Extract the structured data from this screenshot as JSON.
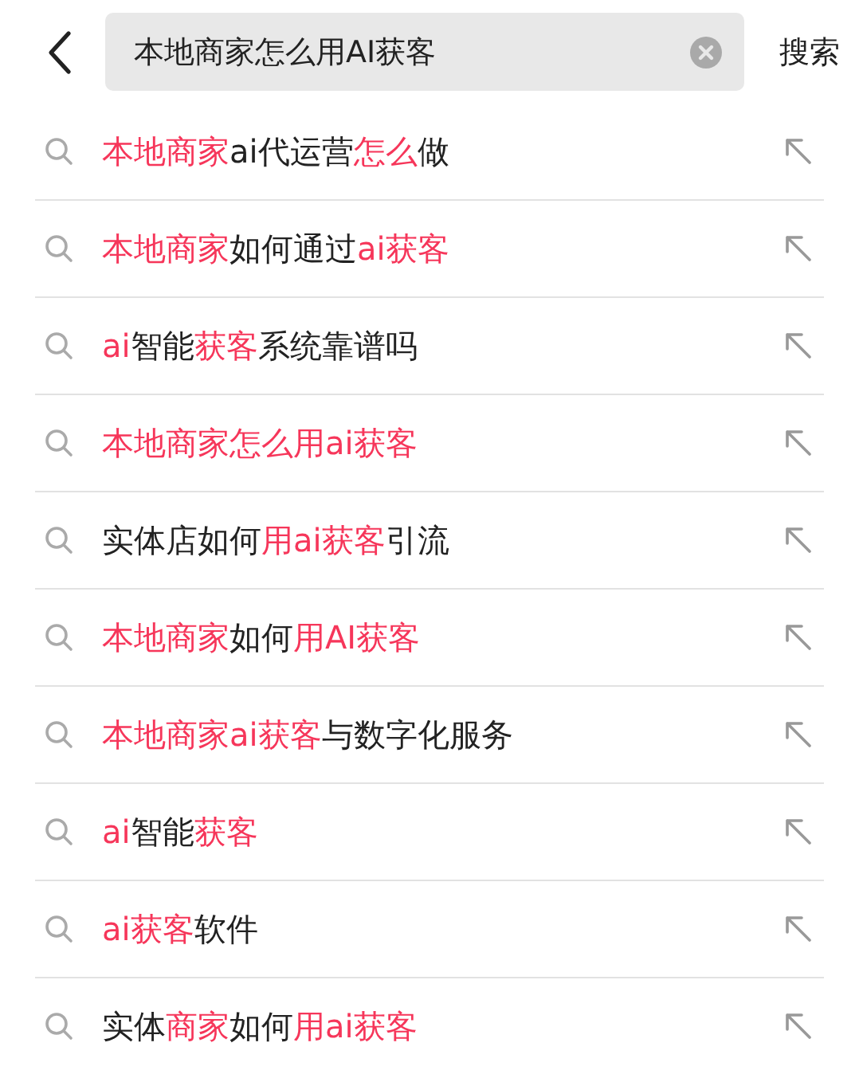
{
  "search_bar": {
    "value": "本地商家怎么用AI获客",
    "submit": "搜索"
  },
  "suggestions": [
    {
      "segments": [
        {
          "text": "本地商家",
          "highlight": true
        },
        {
          "text": "ai代运营",
          "highlight": false
        },
        {
          "text": "怎么",
          "highlight": true
        },
        {
          "text": "做",
          "highlight": false
        }
      ]
    },
    {
      "segments": [
        {
          "text": "本地商家",
          "highlight": true
        },
        {
          "text": "如何通过",
          "highlight": false
        },
        {
          "text": "ai获客",
          "highlight": true
        }
      ]
    },
    {
      "segments": [
        {
          "text": "ai",
          "highlight": true
        },
        {
          "text": "智能",
          "highlight": false
        },
        {
          "text": "获客",
          "highlight": true
        },
        {
          "text": "系统靠谱吗",
          "highlight": false
        }
      ]
    },
    {
      "segments": [
        {
          "text": "本地商家怎么用ai获客",
          "highlight": true
        }
      ]
    },
    {
      "segments": [
        {
          "text": "实体店如何",
          "highlight": false
        },
        {
          "text": "用ai获客",
          "highlight": true
        },
        {
          "text": "引流",
          "highlight": false
        }
      ]
    },
    {
      "segments": [
        {
          "text": "本地商家",
          "highlight": true
        },
        {
          "text": "如何",
          "highlight": false
        },
        {
          "text": "用AI获客",
          "highlight": true
        }
      ]
    },
    {
      "segments": [
        {
          "text": "本地商家ai获客",
          "highlight": true
        },
        {
          "text": "与数字化服务",
          "highlight": false
        }
      ]
    },
    {
      "segments": [
        {
          "text": "ai",
          "highlight": true
        },
        {
          "text": "智能",
          "highlight": false
        },
        {
          "text": "获客",
          "highlight": true
        }
      ]
    },
    {
      "segments": [
        {
          "text": "ai获客",
          "highlight": true
        },
        {
          "text": "软件",
          "highlight": false
        }
      ]
    },
    {
      "segments": [
        {
          "text": "实体",
          "highlight": false
        },
        {
          "text": "商家",
          "highlight": true
        },
        {
          "text": "如何",
          "highlight": false
        },
        {
          "text": "用ai获客",
          "highlight": true
        }
      ]
    }
  ]
}
